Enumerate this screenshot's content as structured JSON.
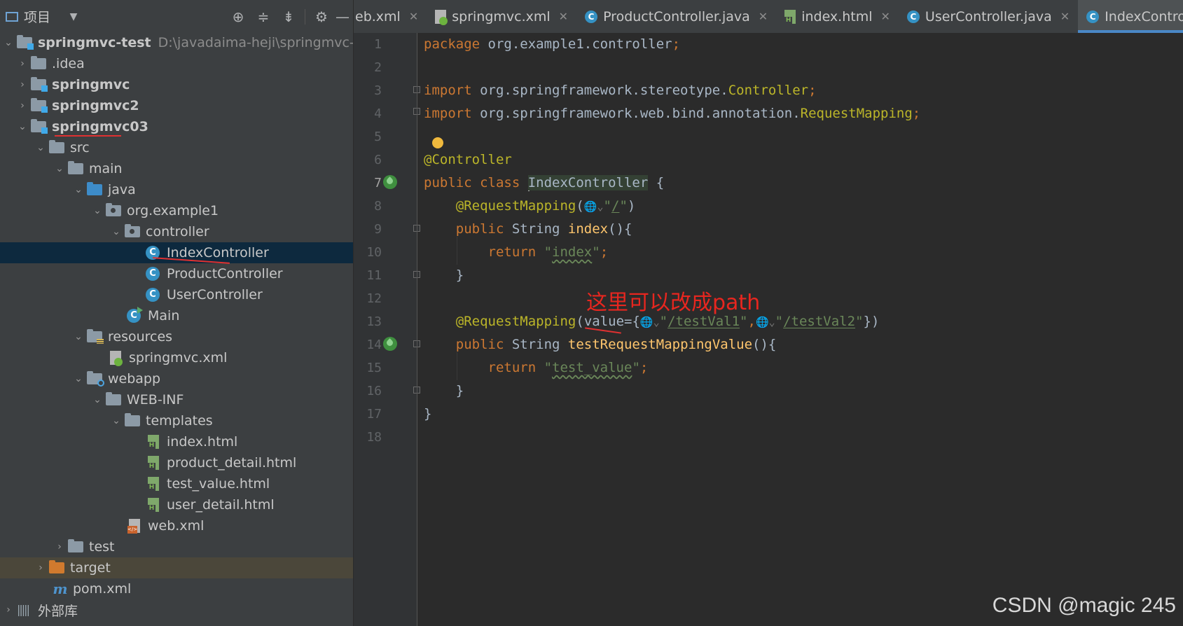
{
  "project_panel": {
    "title": "项目",
    "root": {
      "name": "springmvc-test",
      "path": "D:\\javadaima-heji\\springmvc-test"
    },
    "items": [
      {
        "label": ".idea"
      },
      {
        "label": "springmvc"
      },
      {
        "label": "springmvc2"
      },
      {
        "label": "springmvc03"
      },
      {
        "label": "src"
      },
      {
        "label": "main"
      },
      {
        "label": "java"
      },
      {
        "label": "org.example1"
      },
      {
        "label": "controller"
      },
      {
        "label": "IndexController"
      },
      {
        "label": "ProductController"
      },
      {
        "label": "UserController"
      },
      {
        "label": "Main"
      },
      {
        "label": "resources"
      },
      {
        "label": "springmvc.xml"
      },
      {
        "label": "webapp"
      },
      {
        "label": "WEB-INF"
      },
      {
        "label": "templates"
      },
      {
        "label": "index.html"
      },
      {
        "label": "product_detail.html"
      },
      {
        "label": "test_value.html"
      },
      {
        "label": "user_detail.html"
      },
      {
        "label": "web.xml"
      },
      {
        "label": "test"
      },
      {
        "label": "target"
      },
      {
        "label": "pom.xml"
      },
      {
        "label": "外部库"
      }
    ]
  },
  "tabs": [
    {
      "label": "eb.xml",
      "icon": "xml-file-icon"
    },
    {
      "label": "springmvc.xml",
      "icon": "spring-xml-icon"
    },
    {
      "label": "ProductController.java",
      "icon": "class-icon"
    },
    {
      "label": "index.html",
      "icon": "html-file-icon"
    },
    {
      "label": "UserController.java",
      "icon": "class-icon"
    },
    {
      "label": "IndexController.jav",
      "icon": "class-icon",
      "active": true
    }
  ],
  "editor": {
    "line_numbers": [
      "1",
      "2",
      "3",
      "4",
      "5",
      "6",
      "7",
      "8",
      "9",
      "10",
      "11",
      "12",
      "13",
      "14",
      "15",
      "16",
      "17",
      "18"
    ],
    "code": {
      "l1_kw": "package",
      "l1_rest": " org.example1.controller",
      "l1_semi": ";",
      "l3_kw": "import",
      "l3_pkg": " org.springframework.stereotype.",
      "l3_cls": "Controller",
      "l3_semi": ";",
      "l4_kw": "import",
      "l4_pkg": " org.springframework.web.bind.annotation.",
      "l4_cls": "RequestMapping",
      "l4_semi": ";",
      "l6_ann": "@Controller",
      "l7_kw": "public class ",
      "l7_cls": "IndexController",
      "l7_rest": " {",
      "l8_ann": "@RequestMapping",
      "l8_open": "(",
      "l8_q1": "\"",
      "l8_path": "/",
      "l8_q2": "\"",
      "l8_close": ")",
      "l9_kw": "public ",
      "l9_type": "String ",
      "l9_fn": "index",
      "l9_rest": "(){",
      "l10_kw": "return ",
      "l10_q1": "\"",
      "l10_str": "index",
      "l10_q2": "\"",
      "l10_semi": ";",
      "l11": "}",
      "l13_ann": "@RequestMapping",
      "l13_open": "(",
      "l13_param": "value",
      "l13_eq": "={",
      "l13_q1": "\"",
      "l13_path1": "/testVal1",
      "l13_q2": "\"",
      "l13_comma": ",",
      "l13_q3": "\"",
      "l13_path2": "/testVal2",
      "l13_q4": "\"",
      "l13_close": "})",
      "l14_kw": "public ",
      "l14_type": "String ",
      "l14_fn": "testRequestMappingValue",
      "l14_rest": "(){",
      "l15_kw": "return ",
      "l15_q1": "\"",
      "l15_str": "test_value",
      "l15_q2": "\"",
      "l15_semi": ";",
      "l16": "}",
      "l17": "}"
    }
  },
  "annotation_text": "这里可以改成path",
  "watermark": "CSDN @magic 245",
  "colors": {
    "panel_bg": "#3c3f41",
    "editor_bg": "#2b2b2b",
    "selection": "#0d293e",
    "keyword": "#cc7832",
    "annotation": "#bbb529",
    "string": "#6a8759",
    "method": "#ffc66d",
    "red_markup": "#e03131"
  }
}
